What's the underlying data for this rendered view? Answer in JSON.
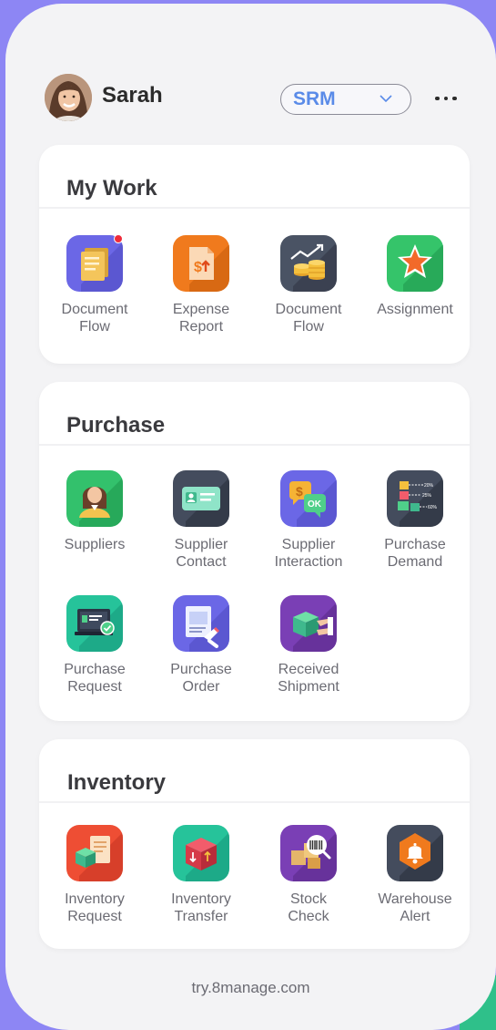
{
  "user": {
    "name": "Sarah"
  },
  "app_switcher": {
    "value": "SRM"
  },
  "sections": {
    "my_work": {
      "title": "My Work",
      "items": [
        {
          "label": "Document\nFlow",
          "icon": "document-stack-icon",
          "color": "#6b67e6",
          "has_badge": true
        },
        {
          "label": "Expense\nReport",
          "icon": "expense-report-icon",
          "color": "#f07a1d"
        },
        {
          "label": "Document\nFlow",
          "icon": "coins-growth-icon",
          "color": "#4a5364"
        },
        {
          "label": "Assignment",
          "icon": "star-icon",
          "color": "#35c46a"
        }
      ]
    },
    "purchase": {
      "title": "Purchase",
      "items": [
        {
          "label": "Suppliers",
          "icon": "supplier-person-icon",
          "color": "#33c16c"
        },
        {
          "label": "Supplier\nContact",
          "icon": "contact-card-icon",
          "color": "#444c5d"
        },
        {
          "label": "Supplier\nInteraction",
          "icon": "chat-bubbles-icon",
          "color": "#6b67e6"
        },
        {
          "label": "Purchase\nDemand",
          "icon": "boxes-chart-icon",
          "color": "#444c5d"
        },
        {
          "label": "Purchase\nRequest",
          "icon": "laptop-check-icon",
          "color": "#26c39a"
        },
        {
          "label": "Purchase\nOrder",
          "icon": "signed-document-icon",
          "color": "#6b67e6"
        },
        {
          "label": "Received\nShipment",
          "icon": "package-hand-icon",
          "color": "#7a3fb5"
        }
      ]
    },
    "inventory": {
      "title": "Inventory",
      "items": [
        {
          "label": "Inventory\nRequest",
          "icon": "inventory-request-icon",
          "color": "#ee4e34"
        },
        {
          "label": "Inventory\nTransfer",
          "icon": "box-arrows-icon",
          "color": "#26c39a"
        },
        {
          "label": "Stock\nCheck",
          "icon": "barcode-scan-icon",
          "color": "#7a3fb5"
        },
        {
          "label": "Warehouse\nAlert",
          "icon": "bell-alert-icon",
          "color": "#444c5d"
        }
      ]
    }
  },
  "footer": {
    "url": "try.8manage.com"
  }
}
